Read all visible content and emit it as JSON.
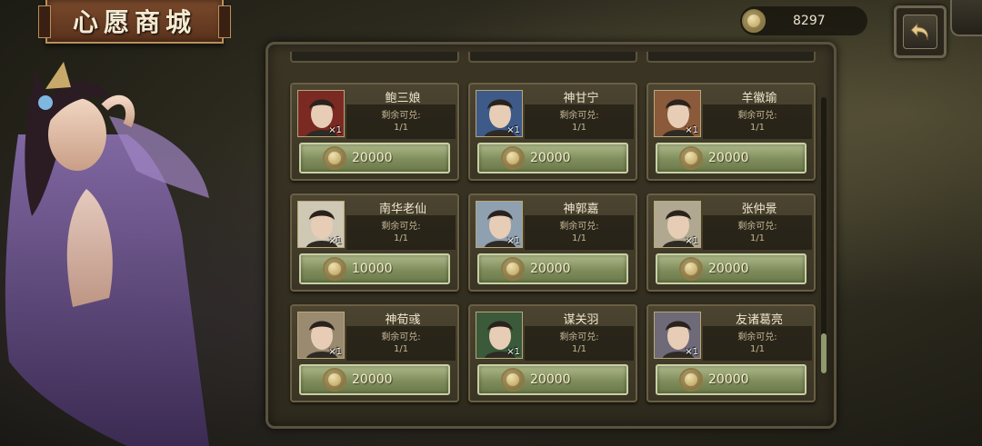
{
  "header": {
    "title": "心愿商城",
    "currency_icon": "coin-icon",
    "currency_amount": "8297",
    "back_icon": "back-arrow-icon"
  },
  "shop": {
    "remain_label": "剩余可兑:",
    "items": [
      {
        "name": "鲍三娘",
        "qty": "×1",
        "remain": "1/1",
        "price": "20000",
        "portrait_color": "#7a2a22"
      },
      {
        "name": "神甘宁",
        "qty": "×1",
        "remain": "1/1",
        "price": "20000",
        "portrait_color": "#3d5a88"
      },
      {
        "name": "羊徽瑜",
        "qty": "×1",
        "remain": "1/1",
        "price": "20000",
        "portrait_color": "#8a5a3a"
      },
      {
        "name": "南华老仙",
        "qty": "×1",
        "remain": "1/1",
        "price": "10000",
        "portrait_color": "#cfc8b4"
      },
      {
        "name": "神郭嘉",
        "qty": "×1",
        "remain": "1/1",
        "price": "20000",
        "portrait_color": "#8fa0b0"
      },
      {
        "name": "张仲景",
        "qty": "×1",
        "remain": "1/1",
        "price": "20000",
        "portrait_color": "#b0a890"
      },
      {
        "name": "神荀彧",
        "qty": "×1",
        "remain": "1/1",
        "price": "20000",
        "portrait_color": "#9a8a70"
      },
      {
        "name": "谋关羽",
        "qty": "×1",
        "remain": "1/1",
        "price": "20000",
        "portrait_color": "#3a5a3a"
      },
      {
        "name": "友诸葛亮",
        "qty": "×1",
        "remain": "1/1",
        "price": "20000",
        "portrait_color": "#6e6a78"
      }
    ]
  },
  "scroll": {
    "position": 1.0
  }
}
